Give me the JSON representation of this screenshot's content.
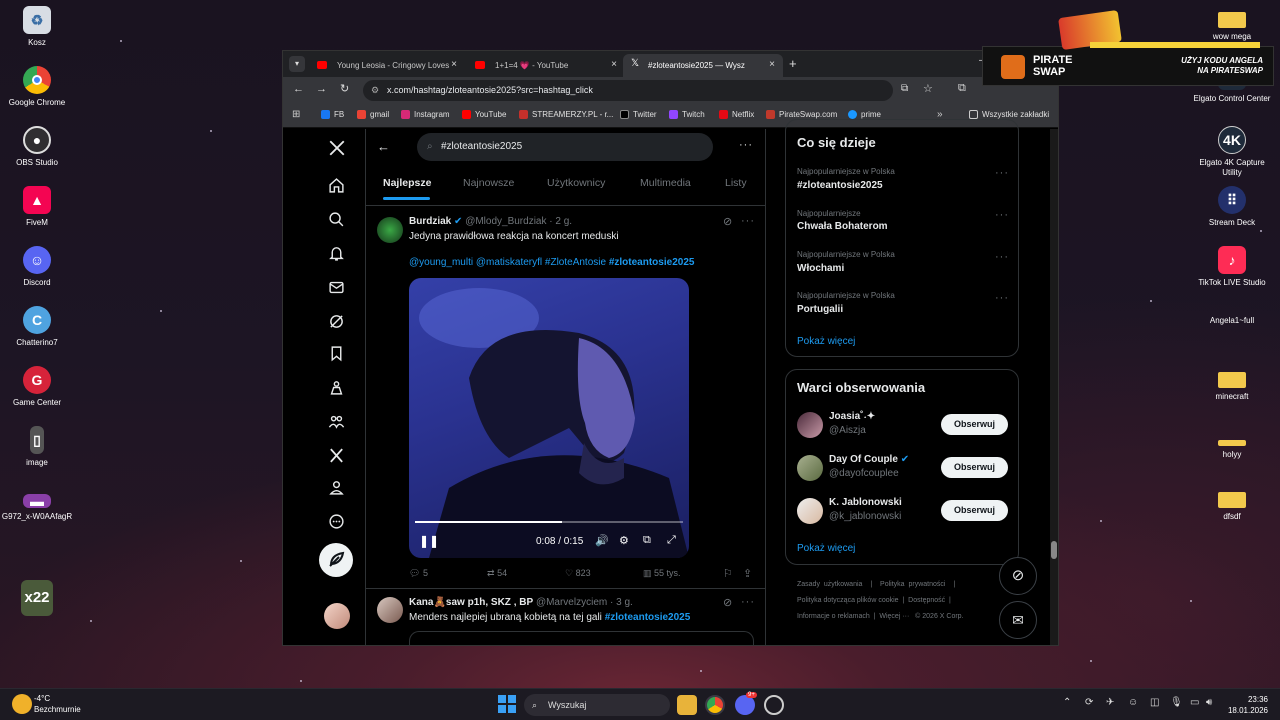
{
  "desktop": {
    "left_icons": [
      "Kosz",
      "Google Chrome",
      "OBS Studio",
      "FiveM",
      "Discord",
      "Chatterino7",
      "Game Center",
      "image",
      "G972_x-W0AAfagR"
    ],
    "right_icons": [
      "wow mega",
      "Elgato Control Center",
      "Elgato 4K Capture Utility",
      "Stream Deck",
      "TikTok LIVE Studio",
      "Angela1~full",
      "minecraft",
      "holyy",
      "dfsdf"
    ]
  },
  "ad": {
    "brand_line1": "PIRATE",
    "brand_line2": "SWAP",
    "promo_line1": "UŻYJ KODU ANGELA",
    "promo_line2": "NA PIRATESWAP"
  },
  "browser": {
    "tabs": [
      {
        "title": "Young Leosia - Cringowy Loves"
      },
      {
        "title": "1+1=4 💗 - YouTube"
      },
      {
        "title": "#zloteantosie2025 — Wysz"
      }
    ],
    "url": "x.com/hashtag/zloteantosie2025?src=hashtag_click",
    "bookmarks": [
      "FB",
      "gmail",
      "Instagram",
      "YouTube",
      "STREAMERZY.PL - r...",
      "Twitter",
      "Twitch",
      "Netflix",
      "PirateSwap.com",
      "prime"
    ],
    "bookmarks_folder": "Wszystkie zakładki"
  },
  "x": {
    "search_value": "#zloteantosie2025",
    "tabs": [
      "Najlepsze",
      "Najnowsze",
      "Użytkownicy",
      "Multimedia",
      "Listy"
    ],
    "tweet1": {
      "name": "Burdziak",
      "handle": "@Mlody_Burdziak",
      "time": "· 2 g.",
      "text": "Jedyna prawidłowa reakcja na koncert meduski",
      "tags": "@young_multi @matiskateryfl #ZloteAntosie",
      "tag_bold": "#zloteantosie2025",
      "video_time": "0:08 / 0:15",
      "video_progress": 0.55,
      "replies": "5",
      "reposts": "54",
      "likes": "823",
      "views": "55 tys."
    },
    "tweet2": {
      "name": "Kana🧸saw p1h, SKZ , BP",
      "handle": "@Marvelzyciem",
      "time": "· 3 g.",
      "text": "Menders najlepiej ubraną kobietą na tej gali",
      "tag": "#zloteantosie2025"
    },
    "trends": {
      "title": "Co się dzieje",
      "items": [
        {
          "context": "Najpopularniejsze w Polska",
          "name": "#zloteantosie2025"
        },
        {
          "context": "Najpopularniejsze",
          "name": "Chwała Bohaterom"
        },
        {
          "context": "Najpopularniejsze w Polska",
          "name": "Włochami"
        },
        {
          "context": "Najpopularniejsze w Polska",
          "name": "Portugalii"
        }
      ],
      "show_more": "Pokaż więcej"
    },
    "who_to_follow": {
      "title": "Warci obserwowania",
      "users": [
        {
          "name": "Joasia˚˖✦",
          "handle": "@Aiszja",
          "verified": false
        },
        {
          "name": "Day Of Couple",
          "handle": "@dayofcouplee",
          "verified": true
        },
        {
          "name": "K. Jablonowski",
          "handle": "@k_jablonowski",
          "verified": false
        }
      ],
      "follow_label": "Obserwuj",
      "show_more": "Pokaż więcej"
    },
    "footer": {
      "line1": [
        "Zasady użytkowania",
        "|",
        "Polityka prywatności",
        "|"
      ],
      "line2": [
        "Polityka dotycząca plików cookie",
        "|",
        "Dostępność",
        "|"
      ],
      "line3": [
        "Informacje o reklamach",
        "|",
        "Więcej ···",
        "© 2026 X Corp."
      ]
    }
  },
  "taskbar": {
    "weather_temp": "-4°C",
    "weather_desc": "Bezchmurnie",
    "search": "Wyszukaj",
    "time": "23:36",
    "date": "18.01.2026",
    "discord_badge": "9+"
  }
}
